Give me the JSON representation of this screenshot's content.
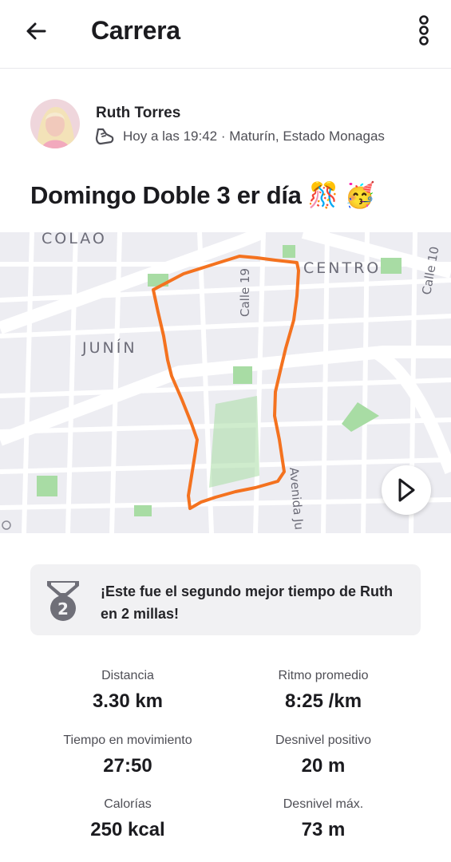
{
  "header": {
    "title": "Carrera",
    "back_icon": "arrow-left-icon",
    "more_icon": "more-vertical-icon"
  },
  "athlete": {
    "name": "Ruth Torres",
    "activity_icon": "running-shoe-icon",
    "meta": "Hoy a las 19:42 · Maturín, Estado Monagas"
  },
  "activity": {
    "title": "Domingo Doble 3 er día",
    "emojis": [
      "🎊",
      "🥳"
    ]
  },
  "map": {
    "labels": {
      "colao": "COLAO",
      "centro": "CENTRO",
      "junin": "JUNÍN",
      "calle19": "Calle 19",
      "calle10": "Calle 10",
      "avenida": "Avenida Ju"
    },
    "route_color": "#f4721f",
    "play_icon": "play-icon"
  },
  "achievement": {
    "icon": "medal-2-icon",
    "rank": "2",
    "text": "¡Este fue el segundo mejor tiempo de Ruth en 2 millas!"
  },
  "stats": [
    {
      "label": "Distancia",
      "value": "3.30 km"
    },
    {
      "label": "Ritmo promedio",
      "value": "8:25 /km"
    },
    {
      "label": "Tiempo en movimiento",
      "value": "27:50"
    },
    {
      "label": "Desnivel positivo",
      "value": "20 m"
    },
    {
      "label": "Calorías",
      "value": "250 kcal"
    },
    {
      "label": "Desnivel máx.",
      "value": "73 m"
    }
  ],
  "colors": {
    "accent": "#f4721f",
    "text": "#242428",
    "map_background": "#ededf2",
    "park": "#a8dca4"
  }
}
